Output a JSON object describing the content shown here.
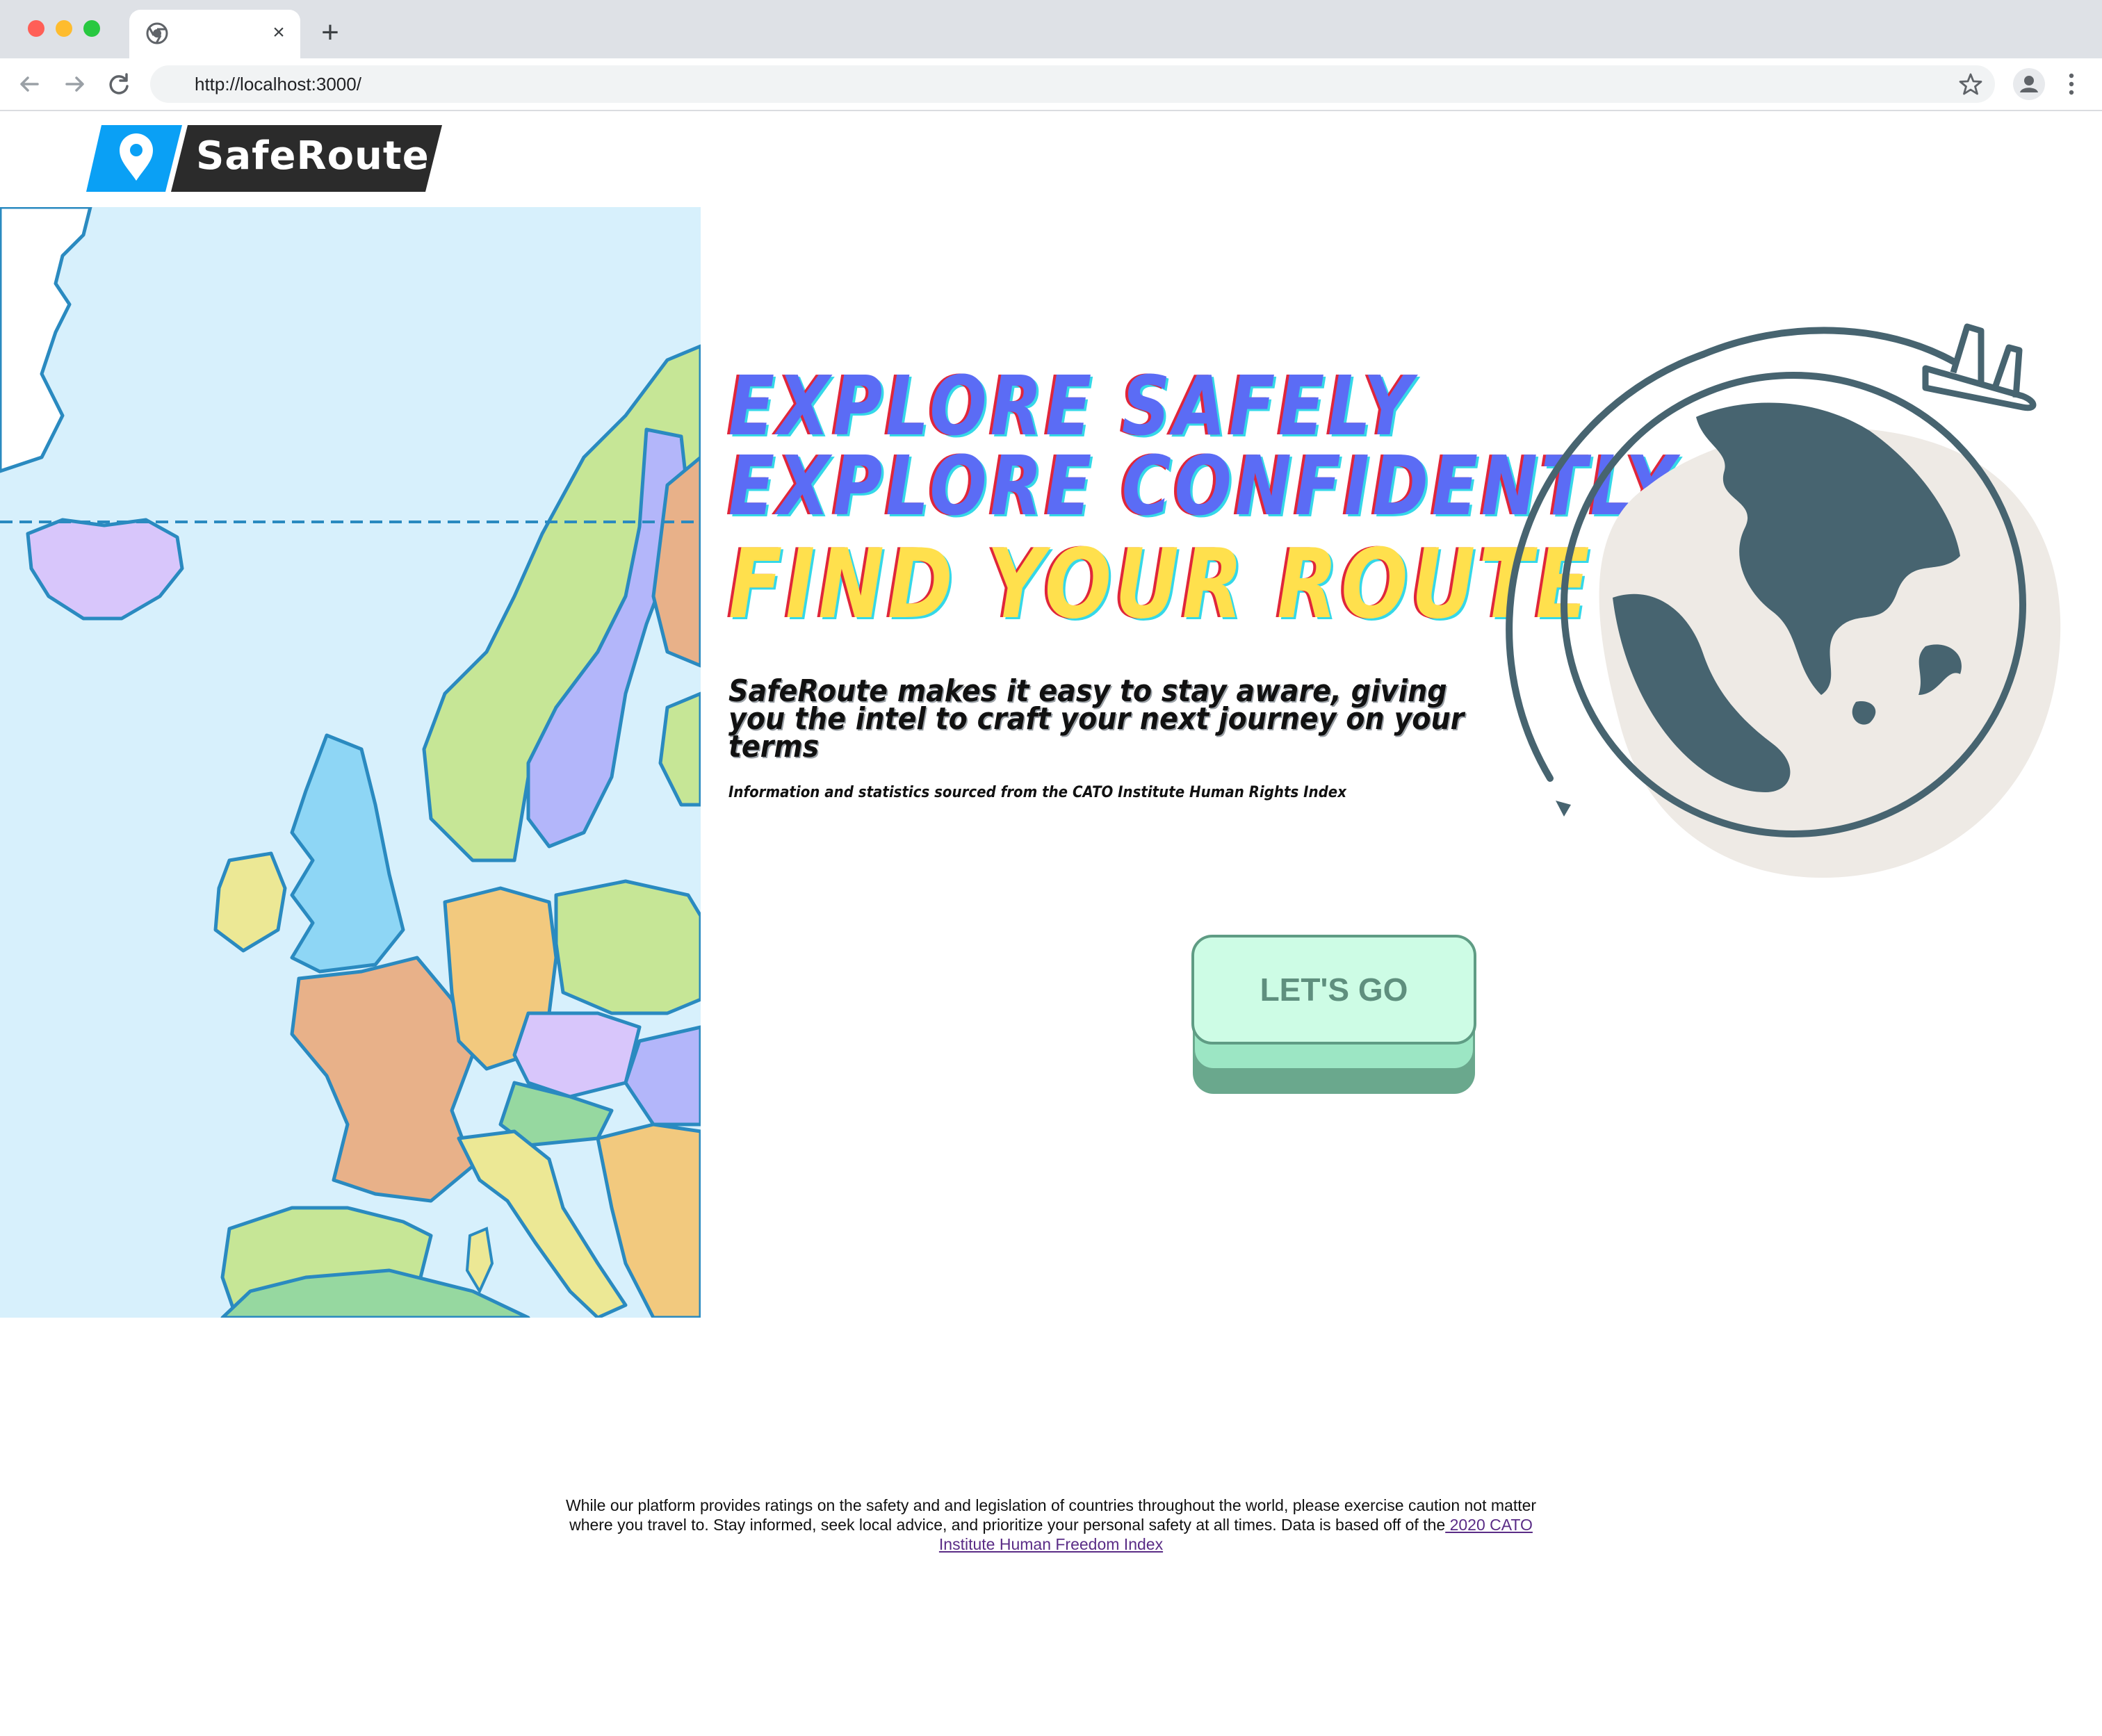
{
  "browser": {
    "url": "http://localhost:3000/",
    "tab_close": "×",
    "new_tab": "+"
  },
  "app": {
    "name": "SafeRoute"
  },
  "hero": {
    "line1": "EXPLORE SAFELY",
    "line2": "EXPLORE CONFIDENTLY",
    "line3": "FIND YOUR ROUTE",
    "tagline": "SafeRoute makes it easy to stay aware, giving you the intel to craft your next journey on your terms",
    "source": "Information and statistics sourced from the CATO Institute Human Rights Index",
    "cta_label": "LET'S GO"
  },
  "footer": {
    "disclaimer": "While our platform provides ratings on the safety and and legislation of countries throughout the world, please exercise caution not matter where you travel to. Stay informed, seek local advice, and prioritize your personal safety at all times. Data is based off of the",
    "link_text": " 2020 CATO Institute Human Freedom Index"
  },
  "colors": {
    "headline_blue": "#5b6cf5",
    "headline_yellow": "#ffe04d",
    "cta_fill": "#cdfce5",
    "cta_border": "#5f9c84",
    "globe": "#476470",
    "globe_blob": "#eeeae5",
    "logo_blue": "#0aa0f5",
    "logo_dark": "#2b2b2b",
    "map_sea": "#d7f0fc"
  }
}
